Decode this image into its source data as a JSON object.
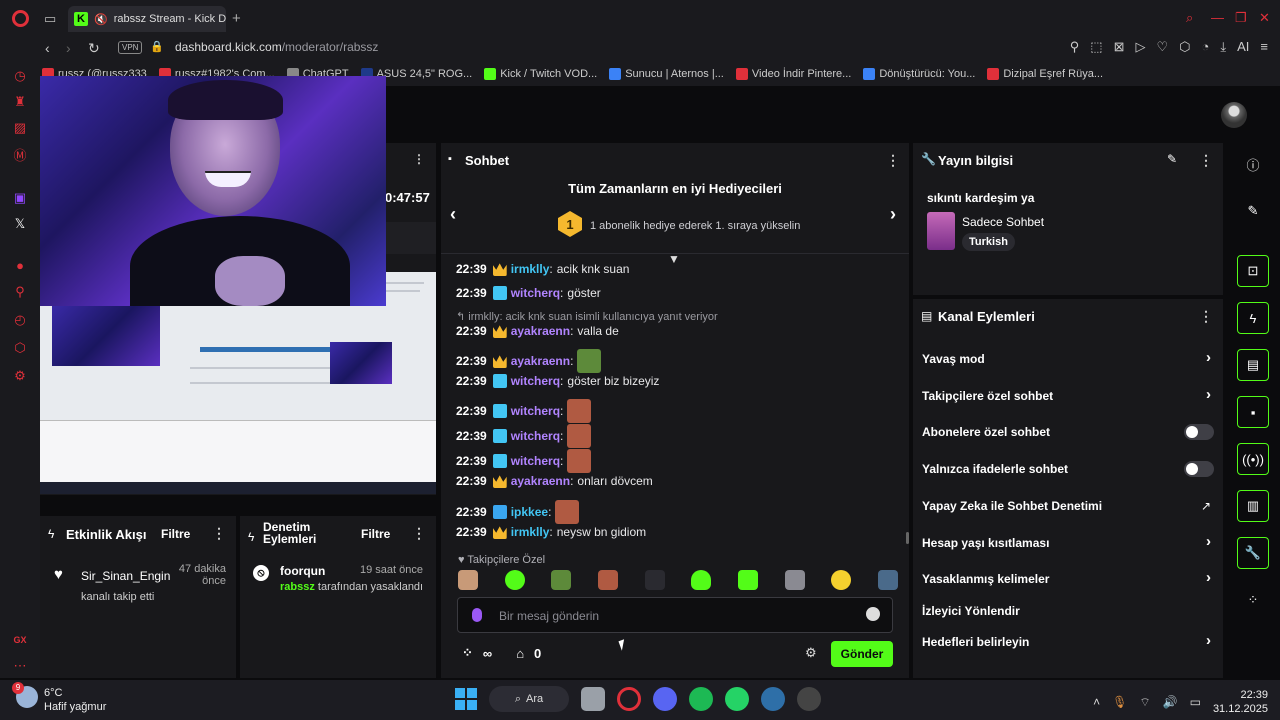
{
  "browser": {
    "tab_title": "rabssz Stream - Kick D",
    "url_domain": "dashboard.kick.com",
    "url_path": "/moderator/rabssz",
    "vpn_label": "VPN",
    "ai_label": "AI"
  },
  "bookmarks": [
    {
      "label": "russz (@russz333",
      "color": "#e0303a"
    },
    {
      "label": "russz#1982's Com...",
      "color": "#e0303a"
    },
    {
      "label": "ChatGPT",
      "color": "#888888"
    },
    {
      "label": "ASUS 24,5\" ROG...",
      "color": "#1e3a8a"
    },
    {
      "label": "Kick / Twitch VOD...",
      "color": "#53fc18"
    },
    {
      "label": "Sunucu | Aternos |...",
      "color": "#3b82f6"
    },
    {
      "label": "Video İndir Pintere...",
      "color": "#e0303a"
    },
    {
      "label": "Dönüştürücü: You...",
      "color": "#3b82f6"
    },
    {
      "label": "Dizipal Eşref Rüya...",
      "color": "#e0303a"
    }
  ],
  "stream": {
    "timer": "0:47:57"
  },
  "events": {
    "title": "Etkinlik Akışı",
    "filter": "Filtre",
    "item": {
      "user": "Sir_Sinan_Engin",
      "time": "47 dakika önce",
      "action": "kanalı takip etti"
    }
  },
  "mod_actions": {
    "title": "Denetim Eylemleri",
    "filter": "Filtre",
    "item": {
      "user": "foorqun",
      "time": "19 saat önce",
      "by": "rabssz",
      "action": "tarafından yasaklandı"
    }
  },
  "chat": {
    "title": "Sohbet",
    "banner_title": "Tüm Zamanların en iyi Hediyecileri",
    "banner_rank": "1",
    "banner_sub": "1 abonelik hediye ederek 1. sıraya yükselin",
    "reply_note": "irmklly: acik knk suan isimli kullanıcıya yanıt veriyor",
    "followers_only": "Takipçilere Özel",
    "input_placeholder": "Bir mesaj gönderin",
    "infinite_label": "∞",
    "points_count": "0",
    "send_label": "Gönder",
    "messages": [
      {
        "time": "22:39",
        "user": "irmklly",
        "user_color": "#42c6f4",
        "badge": "crown",
        "text": "acik knk suan",
        "emotes": 0
      },
      {
        "time": "22:39",
        "user": "witcherq",
        "user_color": "#b184ff",
        "badge": "sub",
        "text": "göster",
        "emotes": 0
      },
      {
        "time": "22:39",
        "user": "ayakraenn",
        "user_color": "#b184ff",
        "badge": "crown",
        "text": "valla de",
        "emotes": 0
      },
      {
        "time": "22:39",
        "user": "ayakraenn",
        "user_color": "#b184ff",
        "badge": "crown",
        "text": "",
        "emotes": 1
      },
      {
        "time": "22:39",
        "user": "witcherq",
        "user_color": "#b184ff",
        "badge": "sub",
        "text": "göster biz bizeyiz",
        "emotes": 0
      },
      {
        "time": "22:39",
        "user": "witcherq",
        "user_color": "#b184ff",
        "badge": "sub",
        "text": "",
        "emotes": 1
      },
      {
        "time": "22:39",
        "user": "witcherq",
        "user_color": "#b184ff",
        "badge": "sub",
        "text": "",
        "emotes": 1
      },
      {
        "time": "22:39",
        "user": "witcherq",
        "user_color": "#b184ff",
        "badge": "sub",
        "text": "",
        "emotes": 1
      },
      {
        "time": "22:39",
        "user": "ayakraenn",
        "user_color": "#b184ff",
        "badge": "crown",
        "text": "onları dövcem",
        "emotes": 0
      },
      {
        "time": "22:39",
        "user": "ipkkee",
        "user_color": "#42c6f4",
        "badge": "vip",
        "text": "",
        "emotes": 1
      },
      {
        "time": "22:39",
        "user": "irmklly",
        "user_color": "#42c6f4",
        "badge": "crown",
        "text": "neysw bn gidiom",
        "emotes": 0
      }
    ]
  },
  "stream_info": {
    "title": "Yayın bilgisi",
    "stream_title": "sıkıntı kardeşim ya",
    "category": "Sadece Sohbet",
    "tag": "Turkish"
  },
  "channel_actions": {
    "title": "Kanal Eylemleri",
    "items": [
      {
        "label": "Yavaş mod",
        "control": "chevron"
      },
      {
        "label": "Takipçilere özel sohbet",
        "control": "chevron"
      },
      {
        "label": "Abonelere özel sohbet",
        "control": "toggle"
      },
      {
        "label": "Yalnızca ifadelerle sohbet",
        "control": "toggle"
      },
      {
        "label": "Yapay Zeka ile Sohbet Denetimi",
        "control": "external"
      },
      {
        "label": "Hesap yaşı kısıtlaması",
        "control": "chevron"
      },
      {
        "label": "Yasaklanmış kelimeler",
        "control": "chevron"
      },
      {
        "label": "İzleyici Yönlendir",
        "control": "none"
      },
      {
        "label": "Hedefleri belirleyin",
        "control": "chevron"
      }
    ]
  },
  "sidebar": {
    "gx_label": "GX"
  },
  "taskbar": {
    "temp": "6°C",
    "weather": "Hafif yağmur",
    "weather_badge": "9",
    "search": "Ara",
    "time": "22:39",
    "date": "31.12.2025"
  }
}
